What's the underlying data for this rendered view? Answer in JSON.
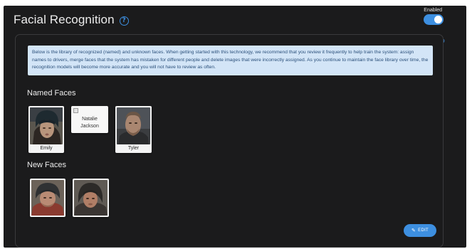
{
  "header": {
    "title": "Facial Recognition",
    "help_icon": "?",
    "toggle_label": "Enabled",
    "toggle_on": true
  },
  "info_text": "Below is the library of recognized (named) and unknown faces. When getting started with this technology, we recommend that you review it frequently to help train the system: assign names to drivers, merge faces that the system has mistaken for different people and delete images that were incorrectly assigned. As you continue to maintain the face library over time, the recognition models will become more accurate and you will not have to review as often.",
  "named_faces": {
    "title": "Named Faces",
    "faces": [
      {
        "name": "Emily"
      },
      {
        "name": "Natalie Jackson",
        "broken": true
      },
      {
        "name": "Tyler"
      }
    ]
  },
  "new_faces": {
    "title": "New Faces",
    "count": 2
  },
  "edit_button": {
    "label": "EDIT"
  },
  "colors": {
    "accent": "#3d8fe0",
    "background": "#1b1b1c",
    "info_bg": "#d3e5f7",
    "info_text": "#2a4f7a"
  }
}
